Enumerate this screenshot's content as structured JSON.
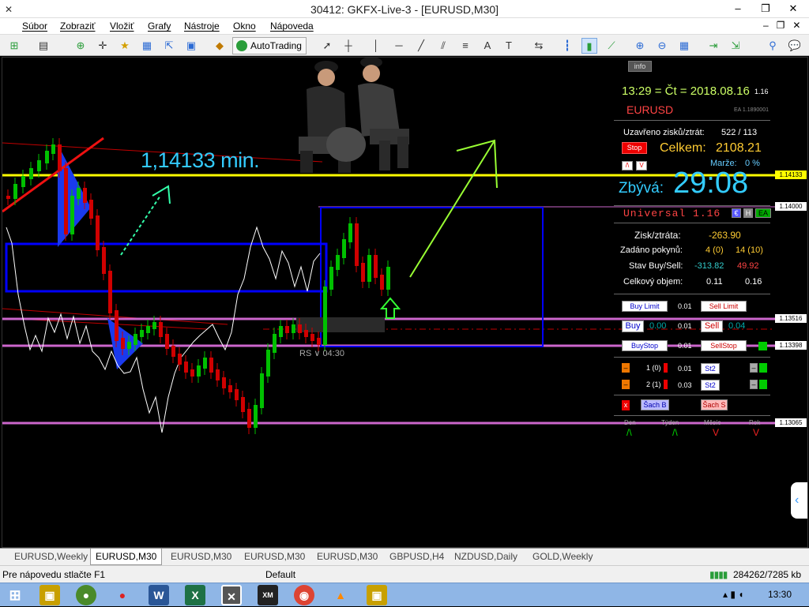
{
  "window": {
    "title": "30412: GKFX-Live-3 - [EURUSD,M30]",
    "minimize": "–",
    "restore": "❐",
    "close": "✕"
  },
  "menu": [
    "Súbor",
    "Zobraziť",
    "Vložiť",
    "Grafy",
    "Nástroje",
    "Okno",
    "Nápoveda"
  ],
  "toolbar": {
    "autotrading_label": "AutoTrading"
  },
  "chart": {
    "min_label": "1,14133 min.",
    "rs_label": "RS ∨ 04:30",
    "info_label": "info",
    "price_labels": [
      {
        "value": "1.14133",
        "color": "#ffff00"
      },
      {
        "value": "1.14000",
        "color": "#ffffff"
      },
      {
        "value": "1.13516",
        "color": "#ffffff"
      },
      {
        "value": "1.13398",
        "color": "#ffffff"
      },
      {
        "value": "1.13065",
        "color": "#ffffff"
      }
    ]
  },
  "panel": {
    "clock": "13:29 = Čt = 2018.08.16",
    "clock_suffix": "1.16",
    "symbol": "EURUSD",
    "ea_code": "EA 1.1890001",
    "closed_label": "Uzavřeno zisků/ztrát:",
    "closed_value": "522 / 113",
    "stop_label": "Stop",
    "total_label": "Celkem:",
    "total_value": "2108.21",
    "margin_label": "Marže:",
    "margin_value": "0 %",
    "remaining_label": "Zbývá:",
    "remaining_value": "29:08",
    "universal": "Universal 1.16",
    "ea_buttons": [
      "€",
      "H",
      "EA"
    ],
    "profit_label": "Zisk/ztráta:",
    "profit_value": "-263.90",
    "orders_label": "Zadáno pokynů:",
    "orders_buy": "4 (0)",
    "orders_sell": "14 (10)",
    "state_label": "Stav Buy/Sell:",
    "state_buy": "-313.82",
    "state_sell": "49.92",
    "volume_label": "Celkový objem:",
    "volume_buy": "0.11",
    "volume_sell": "0.16",
    "buy_limit": "Buy Limit",
    "buy_limit_lot": "0.01",
    "sell_limit": "Sell Limit",
    "buy": "Buy",
    "buy_price": "0.00",
    "trade_lot": "0.01",
    "sell": "Sell",
    "sell_price": "0.04",
    "buy_stop": "BuyStop",
    "buy_stop_lot": "0.01",
    "sell_stop": "SellStop",
    "row1_label": "1 (0)",
    "row1_lot": "0.01",
    "row1_btn": "St2",
    "row2_label": "2 (1)",
    "row2_lot": "0.03",
    "row2_btn": "St2",
    "x_btn": "x",
    "sach_b": "Šach B",
    "sach_s": "Šach S",
    "periods": [
      {
        "name": "Den",
        "arrow": "/\\"
      },
      {
        "name": "Týden",
        "arrow": "/\\"
      },
      {
        "name": "Měsíc",
        "arrow": "V"
      },
      {
        "name": "Rok",
        "arrow": "V"
      }
    ]
  },
  "tabs": [
    "EURUSD,Weekly",
    "EURUSD,M30",
    "EURUSD,M30",
    "EURUSD,M30",
    "EURUSD,M30",
    "GBPUSD,H4",
    "NZDUSD,Daily",
    "GOLD,Weekly"
  ],
  "active_tab": 1,
  "status": {
    "help": "Pre nápovedu stlačte F1",
    "profile": "Default",
    "traffic": "284262/7285 kb"
  },
  "taskbar": {
    "clock": "13:30"
  },
  "colors": {
    "yellow_line": "#ffff00",
    "pink_line": "#cc66cc",
    "blue_box": "#0000ff",
    "bull": "#00c000",
    "bear": "#d00000",
    "accent_cyan": "#33ccff"
  }
}
